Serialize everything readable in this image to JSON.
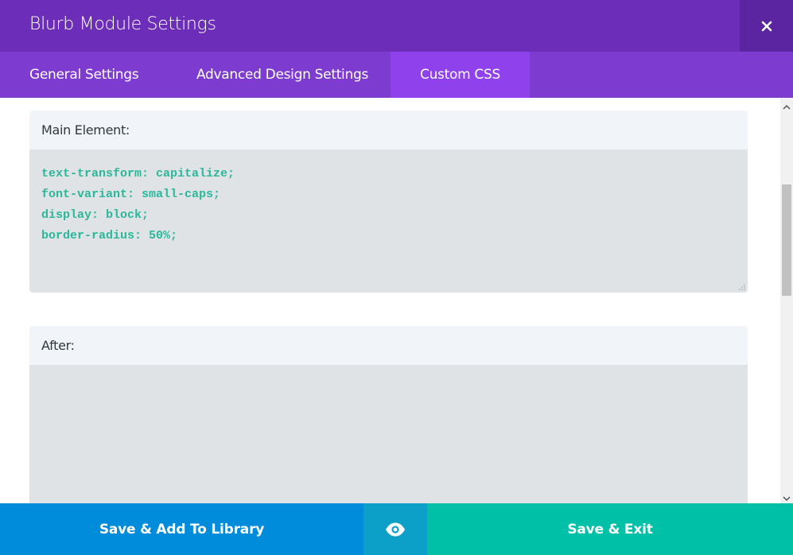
{
  "modal": {
    "title": "Blurb Module Settings"
  },
  "tabs": [
    {
      "label": "General Settings",
      "active": false
    },
    {
      "label": "Advanced Design Settings",
      "active": false
    },
    {
      "label": "Custom CSS",
      "active": true
    }
  ],
  "fields": [
    {
      "label": "Main Element:",
      "lines": [
        "text-transform: capitalize;",
        "font-variant: small-caps;",
        "display: block;",
        "border-radius: 50%;"
      ]
    },
    {
      "label": "After:",
      "lines": []
    }
  ],
  "footer": {
    "save_library_label": "Save & Add To Library",
    "preview_icon": "eye-icon",
    "save_exit_label": "Save & Exit"
  },
  "colors": {
    "header": "#6c2eb9",
    "tabs": "#7e3bd0",
    "active_tab": "#8f42ec",
    "code_text": "#2bb79a",
    "library_button": "#008bdb",
    "preview_button": "#0ca0c8",
    "exit_button": "#00c1a8"
  }
}
